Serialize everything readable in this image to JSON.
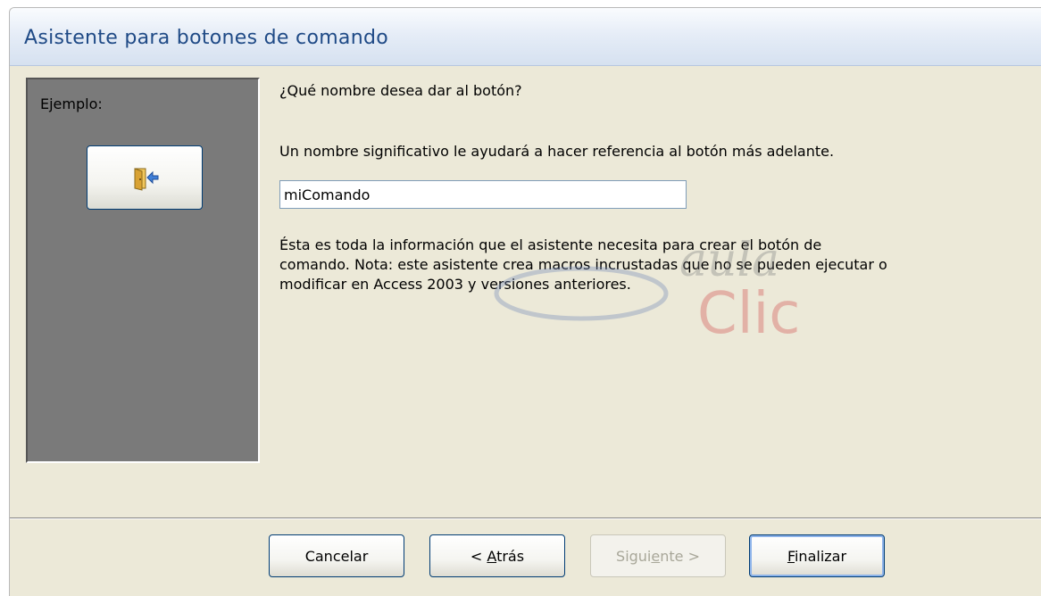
{
  "window": {
    "title": "Asistente para botones de comando"
  },
  "example": {
    "label": "Ejemplo:",
    "button_icon": "exit-door-arrow-icon"
  },
  "content": {
    "question": "¿Qué nombre desea dar al botón?",
    "hint": "Un nombre significativo le ayudará a hacer referencia al botón más adelante.",
    "name_value": "miComando",
    "info_line1": "Ésta es toda la información que el asistente necesita para crear el botón de",
    "info_line2": "comando. Nota: este asistente crea macros incrustadas que no se pueden ejecutar o",
    "info_line3": "modificar en Access 2003 y versiones anteriores."
  },
  "watermark": {
    "line1": "aula",
    "line2": "Clic"
  },
  "buttons": {
    "cancel": "Cancelar",
    "back_pre": "< ",
    "back_key": "A",
    "back_post": "trás",
    "next_pre": "Sigui",
    "next_key": "e",
    "next_post": "nte >",
    "finish_key": "F",
    "finish_post": "inalizar"
  },
  "colors": {
    "title": "#1f4a86",
    "panel": "#7a7a7a",
    "dialog": "#ece9d8",
    "button_border": "#003c74"
  }
}
